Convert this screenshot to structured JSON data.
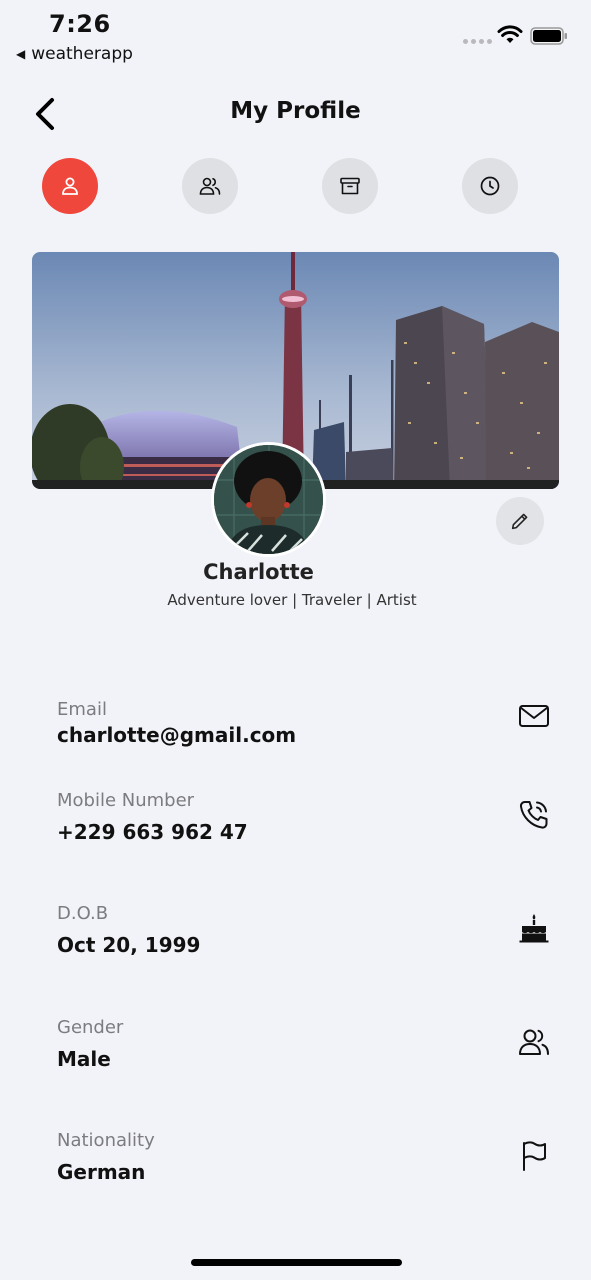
{
  "status_bar": {
    "time": "7:26",
    "back_app": "weatherapp"
  },
  "header": {
    "title": "My Profile"
  },
  "tabs": [
    {
      "icon": "user-icon",
      "active": true
    },
    {
      "icon": "users-icon",
      "active": false
    },
    {
      "icon": "archive-icon",
      "active": false
    },
    {
      "icon": "clock-icon",
      "active": false
    }
  ],
  "profile": {
    "name": "Charlotte",
    "bio": "Adventure lover | Traveler | Artist"
  },
  "fields": [
    {
      "label": "Email",
      "value": "charlotte@gmail.com",
      "icon": "mail-icon"
    },
    {
      "label": "Mobile Number",
      "value": "+229 663 962 47",
      "icon": "phone-icon"
    },
    {
      "label": "D.O.B",
      "value": "Oct 20, 1999",
      "icon": "cake-icon"
    },
    {
      "label": "Gender",
      "value": "Male",
      "icon": "users-icon"
    },
    {
      "label": "Nationality",
      "value": "German",
      "icon": "flag-icon"
    }
  ],
  "colors": {
    "accent": "#f0473c",
    "background": "#f2f3f8",
    "tab_inactive": "#dfe0e4"
  }
}
